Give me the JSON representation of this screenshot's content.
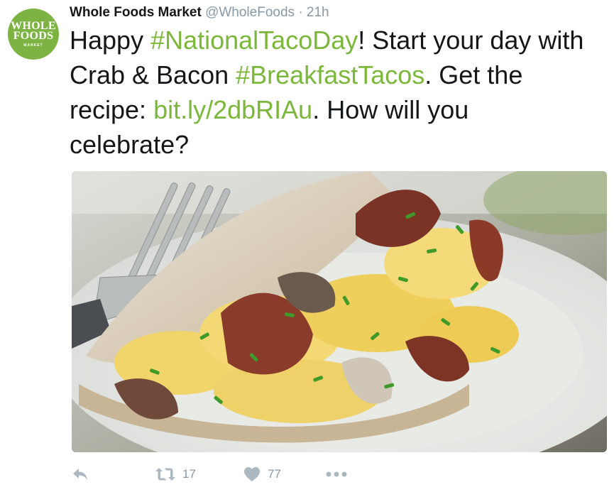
{
  "account": {
    "name": "Whole Foods Market",
    "handle": "@WholeFoods",
    "separator": "·",
    "time": "21h",
    "avatar": {
      "line1": "WHOLE",
      "line2": "FOODS",
      "line3": "MARKET",
      "icon": "whole-foods-logo"
    }
  },
  "tweet": {
    "parts": [
      {
        "text": "Happy ",
        "type": "text"
      },
      {
        "text": "#NationalTacoDay",
        "type": "hashtag"
      },
      {
        "text": "! Start your day with Crab & Bacon ",
        "type": "text"
      },
      {
        "text": "#BreakfastTacos",
        "type": "hashtag"
      },
      {
        "text": ". Get the recipe: ",
        "type": "text"
      },
      {
        "text": "bit.ly/2dbRIAu",
        "type": "link"
      },
      {
        "text": ". How will you celebrate?",
        "type": "text"
      }
    ]
  },
  "media": {
    "kind": "photo"
  },
  "actions": {
    "reply": {
      "icon": "reply-icon"
    },
    "retweet": {
      "icon": "retweet-icon",
      "count": "17"
    },
    "like": {
      "icon": "heart-icon",
      "count": "77"
    },
    "more": {
      "icon": "more-icon"
    }
  },
  "colors": {
    "hashtag": "#7bb83a",
    "brand": "#7cb342",
    "muted": "#8899a6",
    "icon": "#aab8c2"
  }
}
